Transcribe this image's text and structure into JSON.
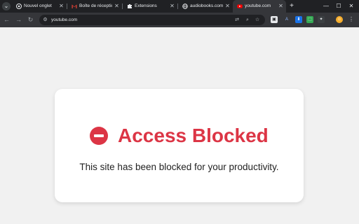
{
  "colors": {
    "accent": "#dc3545",
    "tabstrip_bg": "#202124",
    "toolbar_bg": "#35363a",
    "page_bg": "#f1f1f1"
  },
  "tabs": [
    {
      "label": "Nouvel onglet",
      "icon": "chrome-icon"
    },
    {
      "label": "Boîte de réception",
      "icon": "gmail-icon"
    },
    {
      "label": "Extensions",
      "icon": "puzzle-icon"
    },
    {
      "label": "audiobooks.com",
      "icon": "globe-icon"
    },
    {
      "label": "youtube.com",
      "icon": "youtube-icon",
      "active": true
    }
  ],
  "omnibox": {
    "url": "youtube.com"
  },
  "page": {
    "title": "Access Blocked",
    "message": "This site has been blocked for your productivity."
  }
}
